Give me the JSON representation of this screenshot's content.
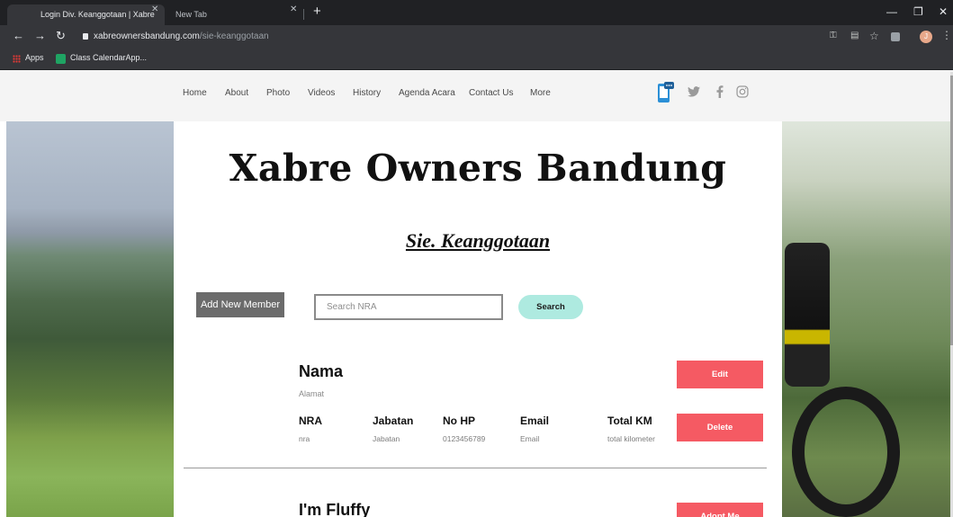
{
  "browser": {
    "tabs": [
      {
        "title": "Login Div. Keanggotaan | Xabre",
        "active": true
      },
      {
        "title": "New Tab",
        "active": false
      }
    ],
    "url_host": "xabreownersbandung.com",
    "url_path": "/sie-keanggotaan",
    "bookmarks": [
      "Apps",
      "Class CalendarApp..."
    ],
    "profile_initial": "J"
  },
  "site": {
    "nav": [
      "Home",
      "About",
      "Photo",
      "Videos",
      "History",
      "Agenda Acara",
      "Contact Us",
      "More"
    ],
    "social_icons": [
      "phone-chat-icon",
      "twitter-icon",
      "facebook-icon",
      "instagram-icon"
    ],
    "title": "Xabre Owners Bandung",
    "subtitle": "Sie. Keanggotaan",
    "add_button": "Add New Member",
    "search_placeholder": "Search NRA",
    "search_button": "Search",
    "member": {
      "name": "Nama",
      "address": "Alamat",
      "fields": [
        {
          "label": "NRA",
          "value": "nra"
        },
        {
          "label": "Jabatan",
          "value": "Jabatan"
        },
        {
          "label": "No HP",
          "value": "0123456789"
        },
        {
          "label": "Email",
          "value": "Email"
        },
        {
          "label": "Total KM",
          "value": "total kilometer"
        }
      ],
      "edit_button": "Edit",
      "delete_button": "Delete"
    },
    "member2": {
      "name": "I'm Fluffy",
      "button": "Adopt Me"
    },
    "colors": {
      "accent_red": "#f55a63",
      "search_teal": "#aeeae0",
      "add_gray": "#6b6b6b"
    }
  }
}
